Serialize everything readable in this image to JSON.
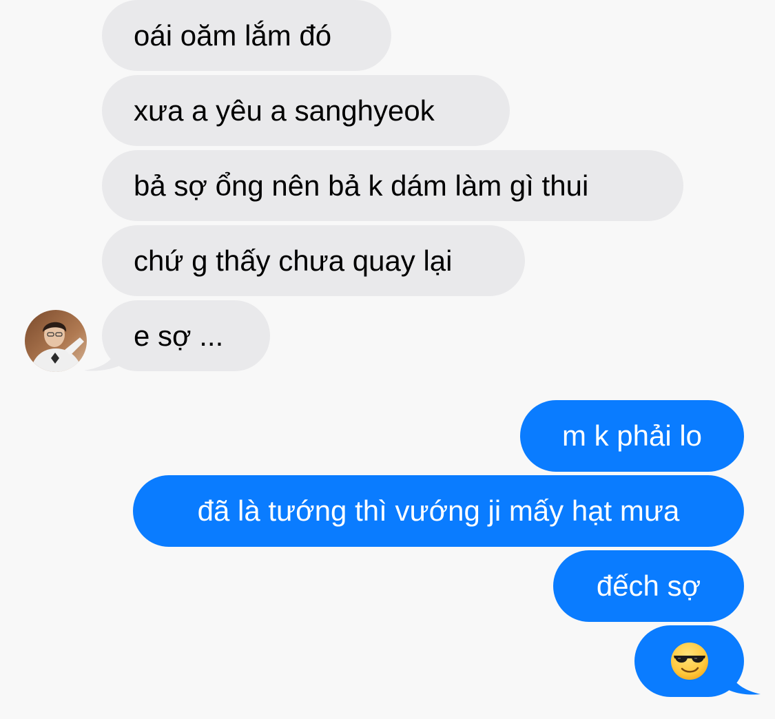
{
  "conversation": {
    "incoming": [
      {
        "text": "oái oăm lắm đó"
      },
      {
        "text": "xưa a yêu a sanghyeok"
      },
      {
        "text": "bả sợ ổng nên bả k dám làm gì thui"
      },
      {
        "text": "chứ g thấy chưa quay lại"
      },
      {
        "text": "e sợ ..."
      }
    ],
    "outgoing": [
      {
        "text": "m k phải lo"
      },
      {
        "text": "đã là tướng thì vướng ji mấy hạt mưa"
      },
      {
        "text": "đếch sợ"
      },
      {
        "emoji": "smiling-face-with-sunglasses"
      }
    ]
  },
  "colors": {
    "background": "#f8f8f8",
    "incoming_bubble": "#e9e9eb",
    "outgoing_bubble": "#0a7cff",
    "outgoing_text": "#ffffff",
    "incoming_text": "#000000"
  }
}
